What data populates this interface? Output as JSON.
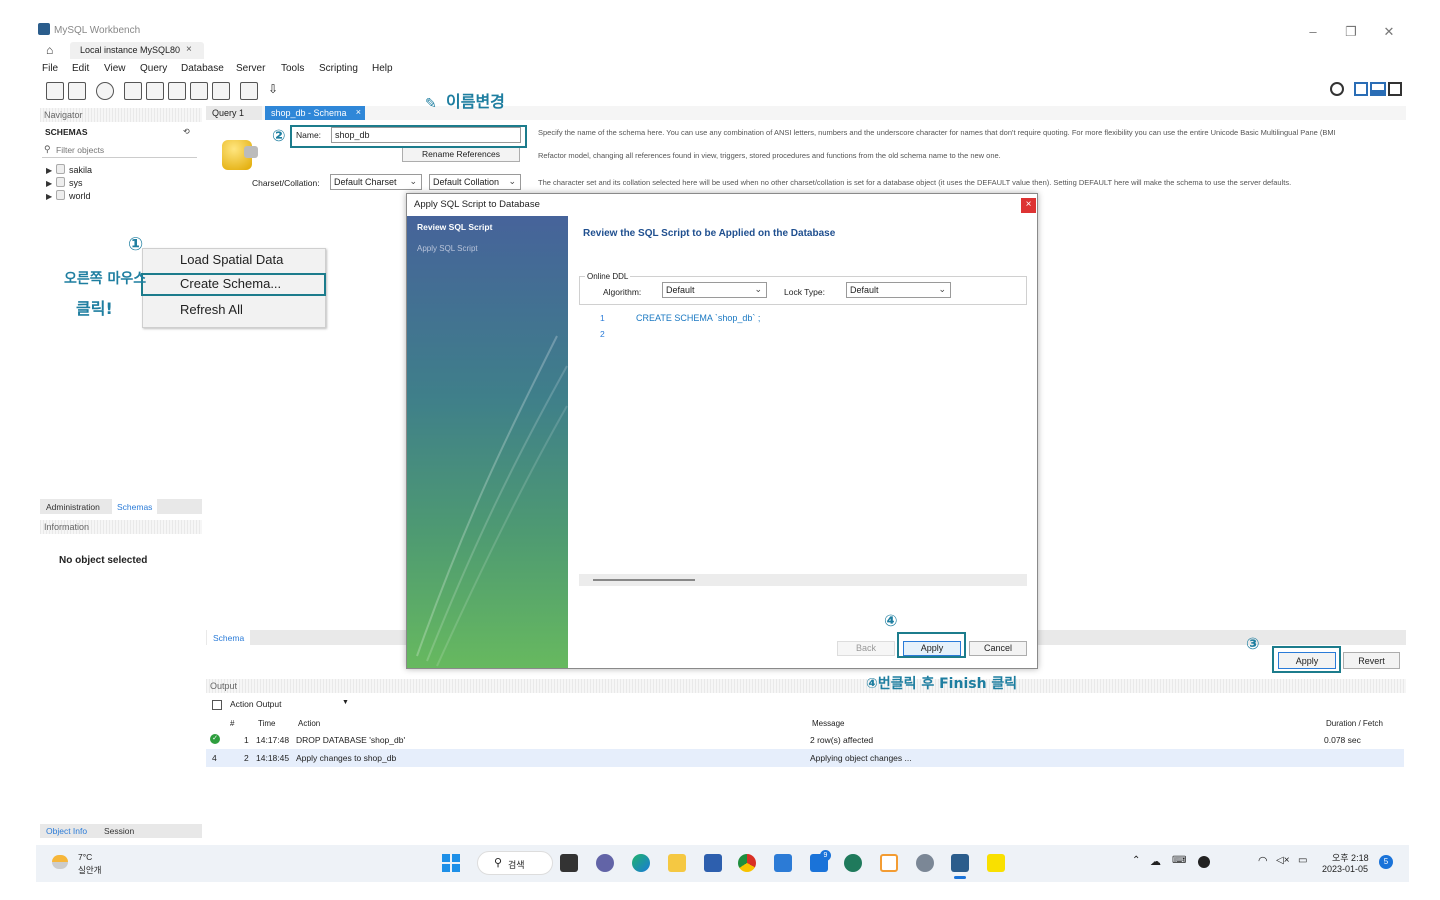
{
  "window": {
    "title": "MySQL Workbench",
    "tab_label": "Local instance MySQL80",
    "tab_close": "×"
  },
  "menu": [
    "File",
    "Edit",
    "View",
    "Query",
    "Database",
    "Server",
    "Tools",
    "Scripting",
    "Help"
  ],
  "navigator": {
    "header": "Navigator",
    "schemas_label": "SCHEMAS",
    "filter_placeholder": "Filter objects",
    "items": [
      "sakila",
      "sys",
      "world"
    ],
    "tabs": [
      "Administration",
      "Schemas"
    ],
    "info_header": "Information",
    "no_object": "No object selected",
    "bottom_tabs": [
      "Object Info",
      "Session"
    ]
  },
  "context_menu": {
    "items": [
      "Load Spatial Data",
      "Create Schema...",
      "Refresh All"
    ]
  },
  "editor_tabs": [
    "Query 1",
    "shop_db - Schema"
  ],
  "schema_editor": {
    "name_label": "Name:",
    "name_value": "shop_db",
    "rename_button": "Rename References",
    "charset_label": "Charset/Collation:",
    "charset_value": "Default Charset",
    "collation_value": "Default Collation",
    "desc_name": "Specify the name of the schema here. You can use any combination of ANSI letters, numbers and the underscore character for names that don't require quoting. For more flexibility you can use the entire Unicode Basic Multilingual Pane (BMI",
    "desc_rename": "Refactor model, changing all references found in view, triggers, stored procedures and functions from the old schema name to the new one.",
    "desc_charset": "The character set and its collation selected here will be used when no other charset/collation is set for a database object (it uses the DEFAULT value then). Setting DEFAULT here will make the schema to use the server defaults.",
    "bottom_tab": "Schema",
    "apply_button": "Apply",
    "revert_button": "Revert"
  },
  "dialog": {
    "title": "Apply SQL Script to Database",
    "close": "×",
    "steps": [
      "Review SQL Script",
      "Apply SQL Script"
    ],
    "heading": "Review the SQL Script to be Applied on the Database",
    "online_ddl": "Online DDL",
    "algorithm_label": "Algorithm:",
    "algorithm_value": "Default",
    "lock_label": "Lock Type:",
    "lock_value": "Default",
    "line_numbers": [
      "1",
      "2"
    ],
    "sql": "CREATE SCHEMA `shop_db` ;",
    "back_button": "Back",
    "apply_button": "Apply",
    "cancel_button": "Cancel"
  },
  "output": {
    "header": "Output",
    "selector": "Action Output",
    "columns": [
      "#",
      "Time",
      "Action",
      "Message",
      "Duration / Fetch"
    ],
    "rows": [
      {
        "num": "1",
        "time": "14:17:48",
        "action": "DROP DATABASE 'shop_db'",
        "message": "2 row(s) affected",
        "duration": "0.078 sec",
        "status": "ok"
      },
      {
        "num": "2",
        "time": "14:18:45",
        "action": "Apply changes to shop_db",
        "message": "Applying object changes ...",
        "duration": "",
        "status": "pending",
        "marker": "4"
      }
    ]
  },
  "annotations": {
    "step1": "①",
    "step1_text_line1": "오른쪽 마우스",
    "step1_text_line2": "클릭!",
    "step2": "②",
    "step2_text": "이름변경",
    "step3": "③",
    "step4": "④",
    "step4_text": "④번클릭 후 Finish 클릭"
  },
  "taskbar": {
    "weather_temp": "7°C",
    "weather_text": "실안개",
    "search_label": "검색",
    "time": "오후 2:18",
    "date": "2023-01-05",
    "notification_count": "5",
    "mail_badge": "9"
  },
  "colors": {
    "accent_blue": "#1f82d6",
    "annotation_teal": "#1c7c8c",
    "dialog_heading": "#1f4f8f",
    "sql_keyword": "#1a78c2",
    "sql_string": "#b03030"
  }
}
